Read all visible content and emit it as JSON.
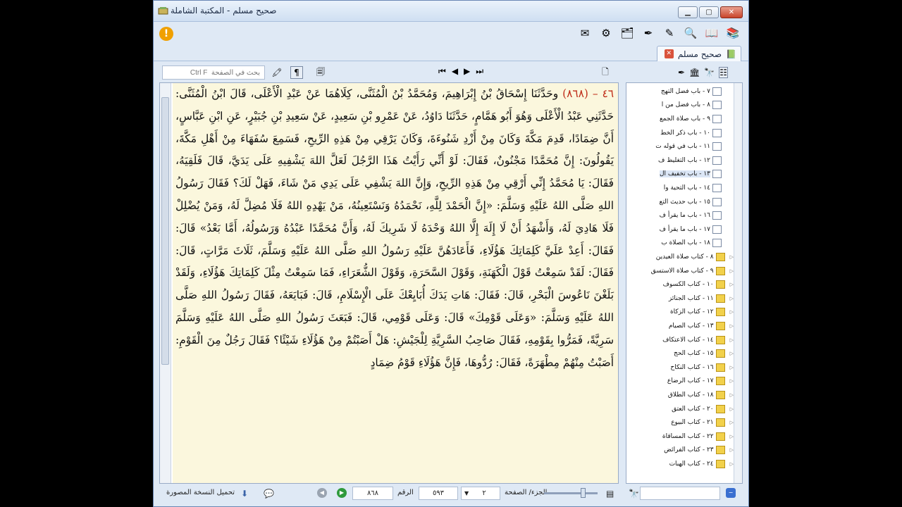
{
  "window": {
    "title": "صحيح مسلم - المكتبة الشاملة"
  },
  "tab": {
    "label": "صحيح مسلم"
  },
  "search": {
    "placeholder": "بحث في الصفحة  Ctrl F"
  },
  "toolbar": {
    "alert_label": "!"
  },
  "text_paragraph": "٤٦ – (٨٦٨) وحَدَّثَنَا إِسْحَاقُ بْنُ إِبْرَاهِيمَ، وَمُحَمَّدُ بْنُ الْمُثَنَّى، كِلَاهُمَا عَنْ عَبْدِ الْأَعْلَى، قَالَ ابْنُ الْمُثَنَّى: حَدَّثَنِي عَبْدُ الْأَعْلَى وَهُوَ أَبُو هَمَّامٍ، حَدَّثَنَا دَاوُدُ، عَنْ عَمْرِو بْنِ سَعِيدٍ، عَنْ سَعِيدِ بْنِ جُبَيْرٍ، عَنِ ابْنِ عَبَّاسٍ، أَنَّ ضِمَادًا، قَدِمَ مَكَّةَ وَكَانَ مِنْ أَزْدِ شَنُوءَةَ، وَكَانَ يَرْقِي مِنْ هَذِهِ الرِّيحِ، فَسَمِعَ سُفَهَاءَ مِنْ أَهْلِ مَكَّةَ، يَقُولُونَ: إِنَّ مُحَمَّدًا مَجْنُونٌ، فَقَالَ: لَوْ أَنِّي رَأَيْتُ هَذَا الرَّجُلَ لَعَلَّ اللهَ يَشْفِيهِ عَلَى يَدَيَّ، قَالَ فَلَقِيَهُ، فَقَالَ: يَا مُحَمَّدُ إِنِّي أَرْقِي مِنْ هَذِهِ الرِّيحِ، وَإِنَّ اللهَ يَشْفِي عَلَى يَدِي مَنْ شَاءَ، فَهَلْ لَكَ؟ فَقَالَ رَسُولُ اللهِ صَلَّى اللهُ عَلَيْهِ وَسَلَّمَ: «إِنَّ الْحَمْدَ لِلَّهِ، نَحْمَدُهُ وَنَسْتَعِينُهُ، مَنْ يَهْدِهِ اللهُ فَلَا مُضِلَّ لَهُ، وَمَنْ يُضْلِلْ فَلَا هَادِيَ لَهُ، وَأَشْهَدُ أَنْ لَا إِلَهَ إِلَّا اللهُ وَحْدَهُ لَا شَرِيكَ لَهُ، وَأَنَّ مُحَمَّدًا عَبْدُهُ وَرَسُولُهُ، أَمَّا بَعْدُ» قَالَ: فَقَالَ: أَعِدْ عَلَيَّ كَلِمَاتِكَ هَؤُلَاءِ، فَأَعَادَهُنَّ عَلَيْهِ رَسُولُ اللهِ صَلَّى اللهُ عَلَيْهِ وَسَلَّمَ، ثَلَاثَ مَرَّاتٍ، قَالَ: فَقَالَ: لَقَدْ سَمِعْتُ قَوْلَ الْكَهَنَةِ، وَقَوْلَ السَّحَرَةِ، وَقَوْلَ الشُّعَرَاءِ، فَمَا سَمِعْتُ مِثْلَ كَلِمَاتِكَ هَؤُلَاءِ، وَلَقَدْ بَلَغْنَ نَاعُوسَ الْبَحْرِ، قَالَ: فَقَالَ: هَاتِ يَدَكَ أُبَايِعْكَ عَلَى الْإِسْلَامِ، قَالَ: فَبَايَعَهُ، فَقَالَ رَسُولُ اللهِ صَلَّى اللهُ عَلَيْهِ وَسَلَّمَ: «وَعَلَى قَوْمِكَ» قَالَ: وَعَلَى قَوْمِي، قَالَ: فَبَعَثَ رَسُولُ اللهِ صَلَّى اللهُ عَلَيْهِ وَسَلَّمَ سَرِيَّةً، فَمَرُّوا بِقَوْمِهِ، فَقَالَ صَاحِبُ السَّرِيَّةِ لِلْجَيْشِ: هَلْ أَصَبْتُمْ مِنْ هَؤُلَاءِ شَيْئًا؟ فَقَالَ رَجُلٌ مِنَ الْقَوْمِ: أَصَبْتُ مِنْهُمْ مِطْهَرَةً، فَقَالَ: رُدُّوهَا، فَإِنَّ هَؤُلَاءِ قَوْمُ ضِمَادٍ",
  "tree": {
    "chapters": [
      "٧ - باب فضل التهج",
      "٨ - باب فضل من ا",
      "٩ - باب صلاة الجمع",
      "١٠ - باب ذكر الخط",
      "١١ - باب في قوله ت",
      "١٢ - باب التغليظ ف",
      "١٣ - باب تخفيف ال",
      "١٤ - باب التحية وا",
      "١٥ - باب حديث التع",
      "١٦ - باب ما يقرأ ف",
      "١٧ - باب ما يقرأ ف",
      "١٨ - باب الصلاة ب"
    ],
    "books": [
      "٨ - كتاب صلاة العيدين",
      "٩ - كتاب صلاة الاستسق",
      "١٠ - كتاب الكسوف",
      "١١ - كتاب الجنائز",
      "١٢ - كتاب الزكاة",
      "١٣ - كتاب الصيام",
      "١٤ - كتاب الاعتكاف",
      "١٥ - كتاب الحج",
      "١٦ - كتاب النكاح",
      "١٧ - كتاب الرضاع",
      "١٨ - كتاب الطلاق",
      "٢٠ - كتاب العتق",
      "٢١ - كتاب البيوع",
      "٢٢ - كتاب المساقاة",
      "٢٣ - كتاب الفرائض",
      "٢٤ - كتاب الهبات"
    ]
  },
  "status": {
    "download_label": "تحميل النسخة المصورة",
    "number": "٨٦٨",
    "number_label": "الرقم",
    "page": "٥٩٣",
    "volume": "٢",
    "volume_page_label": "الجزء/ الصفحة"
  }
}
